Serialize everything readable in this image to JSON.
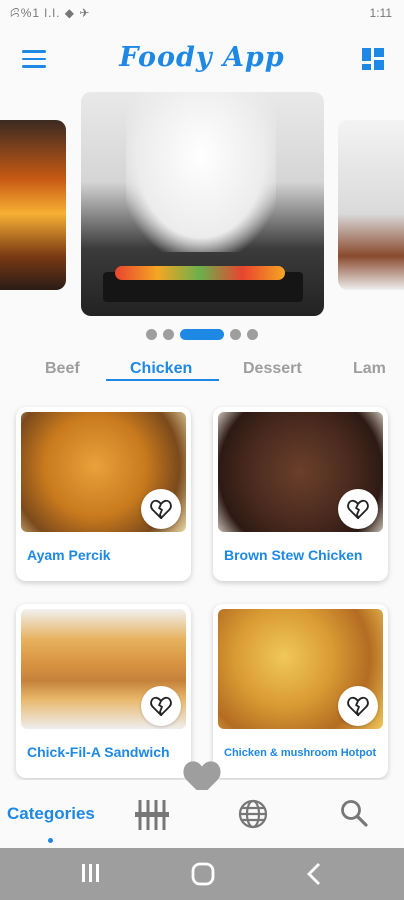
{
  "status_bar": {
    "left": "ꕸ%1 l.l. ◆ ✈",
    "right": "1:11"
  },
  "app": {
    "title": "Foody App"
  },
  "carousel": {
    "slides": 3,
    "dots": 5,
    "active_dot": 2
  },
  "tabs": [
    {
      "label": "Beef"
    },
    {
      "label": "Chicken"
    },
    {
      "label": "Dessert"
    },
    {
      "label": "Lam"
    }
  ],
  "cards": [
    {
      "name": "Ayam Percik"
    },
    {
      "name": "Brown Stew Chicken"
    },
    {
      "name": "Chick-Fil-A Sandwich"
    },
    {
      "name": "Chicken & mushroom Hotpot"
    }
  ],
  "bottom_nav": {
    "categories": "Categories"
  },
  "colors": {
    "accent": "#1e88e5",
    "inactive": "#9e9e9e",
    "sysbar": "#9e9e9e"
  }
}
